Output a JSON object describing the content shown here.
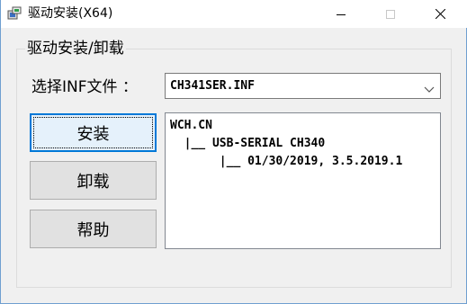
{
  "window": {
    "title": "驱动安装(X64)"
  },
  "group": {
    "title": "驱动安装/卸载"
  },
  "inf": {
    "label": "选择INF文件 ：",
    "selected": "CH341SER.INF"
  },
  "buttons": {
    "install": "安装",
    "uninstall": "卸载",
    "help": "帮助"
  },
  "info": {
    "lines": [
      "WCH.CN",
      "  |__ USB-SERIAL CH340",
      "       |__ 01/30/2019, 3.5.2019.1"
    ]
  },
  "icons": {
    "app": "driver-install-icon",
    "minimize": "minimize-icon",
    "maximize": "maximize-icon",
    "close": "close-icon",
    "dropdown": "chevron-down-icon"
  }
}
